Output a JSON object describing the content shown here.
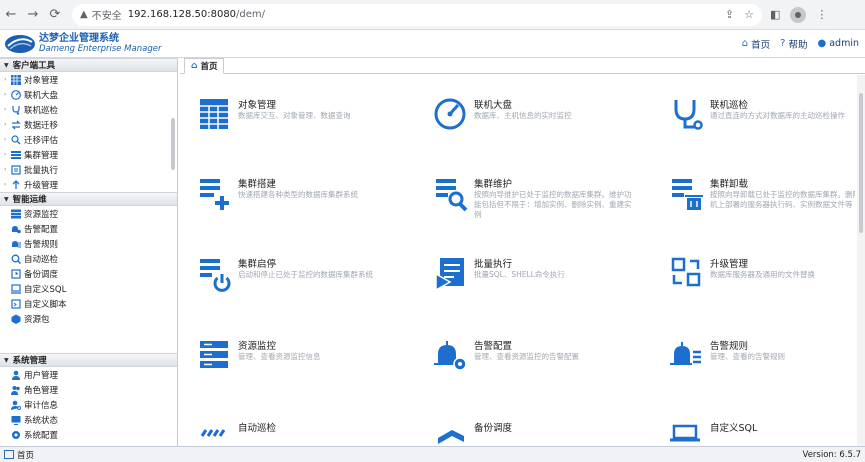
{
  "browser": {
    "insecure_label": "不安全",
    "url_host": "192.168.128.50:8080",
    "url_path": "/dem/"
  },
  "header": {
    "logo_cn": "达梦企业管理系统",
    "logo_en": "Dameng Enterprise Manager",
    "home_label": "首页",
    "help_label": "帮助",
    "user_label": "admin"
  },
  "sidebar": {
    "sections": [
      {
        "title": "客户端工具",
        "items": [
          {
            "label": "对象管理",
            "icon": "grid-icon"
          },
          {
            "label": "联机大盘",
            "icon": "gauge-icon"
          },
          {
            "label": "联机巡检",
            "icon": "stethoscope-icon"
          },
          {
            "label": "数据迁移",
            "icon": "transfer-icon"
          },
          {
            "label": "迁移评估",
            "icon": "evaluate-icon"
          },
          {
            "label": "集群管理",
            "icon": "cluster-icon"
          },
          {
            "label": "批量执行",
            "icon": "batch-icon"
          },
          {
            "label": "升级管理",
            "icon": "upgrade-icon"
          }
        ]
      },
      {
        "title": "智能运维",
        "items": [
          {
            "label": "资源监控",
            "icon": "server-icon"
          },
          {
            "label": "告警配置",
            "icon": "alarm-config-icon"
          },
          {
            "label": "告警规则",
            "icon": "alarm-rule-icon"
          },
          {
            "label": "自动巡检",
            "icon": "auto-inspect-icon"
          },
          {
            "label": "备份调度",
            "icon": "backup-icon"
          },
          {
            "label": "自定义SQL",
            "icon": "sql-icon"
          },
          {
            "label": "自定义脚本",
            "icon": "script-icon"
          },
          {
            "label": "资源包",
            "icon": "package-icon"
          }
        ]
      },
      {
        "title": "系统管理",
        "items": [
          {
            "label": "用户管理",
            "icon": "user-icon"
          },
          {
            "label": "角色管理",
            "icon": "role-icon"
          },
          {
            "label": "审计信息",
            "icon": "audit-icon"
          },
          {
            "label": "系统状态",
            "icon": "status-icon"
          },
          {
            "label": "系统配置",
            "icon": "config-icon"
          }
        ]
      }
    ]
  },
  "tab": {
    "label": "首页"
  },
  "cards": [
    {
      "title": "对象管理",
      "desc": "数据库交互、对象管理、数据查询",
      "icon": "table-grid-icon"
    },
    {
      "title": "联机大盘",
      "desc": "数据库、主机信息的实时监控",
      "icon": "gauge-icon"
    },
    {
      "title": "联机巡检",
      "desc": "通过直连的方式对数据库的主动巡检操作",
      "icon": "stethoscope-icon"
    },
    {
      "title": "集群搭建",
      "desc": "快速搭建各种类型的数据库集群系统",
      "icon": "cluster-add-icon"
    },
    {
      "title": "集群维护",
      "desc": "按照向导维护已处于监控的数据库集群。维护功能包括但不限于：增加实例、删除实例、重建实例",
      "icon": "cluster-maintain-icon"
    },
    {
      "title": "集群卸载",
      "desc": "按照向导卸载已处于监控的数据库集群。删除主机上部署的服务器执行码、实例数据文件等",
      "icon": "cluster-uninstall-icon"
    },
    {
      "title": "集群启停",
      "desc": "启动和停止已处于监控的数据库集群系统",
      "icon": "cluster-power-icon"
    },
    {
      "title": "批量执行",
      "desc": "批量SQL、SHELL命令执行",
      "icon": "batch-exec-icon"
    },
    {
      "title": "升级管理",
      "desc": "数据库服务器及通用的文件替换",
      "icon": "upgrade-icon"
    },
    {
      "title": "资源监控",
      "desc": "管理、查看资源监控信息",
      "icon": "server-icon"
    },
    {
      "title": "告警配置",
      "desc": "管理、查看资源监控的告警配置",
      "icon": "alarm-config-icon"
    },
    {
      "title": "告警规则",
      "desc": "管理、查看的告警规则",
      "icon": "alarm-rule-icon"
    },
    {
      "title": "自动巡检",
      "desc": "",
      "icon": "auto-inspect-icon"
    },
    {
      "title": "备份调度",
      "desc": "",
      "icon": "backup-icon"
    },
    {
      "title": "自定义SQL",
      "desc": "",
      "icon": "sql-icon"
    }
  ],
  "statusbar": {
    "tab_label": "首页",
    "version": "Version: 6.5.7"
  },
  "colors": {
    "accent": "#1d6fcf",
    "brand": "#1c5fb2"
  }
}
